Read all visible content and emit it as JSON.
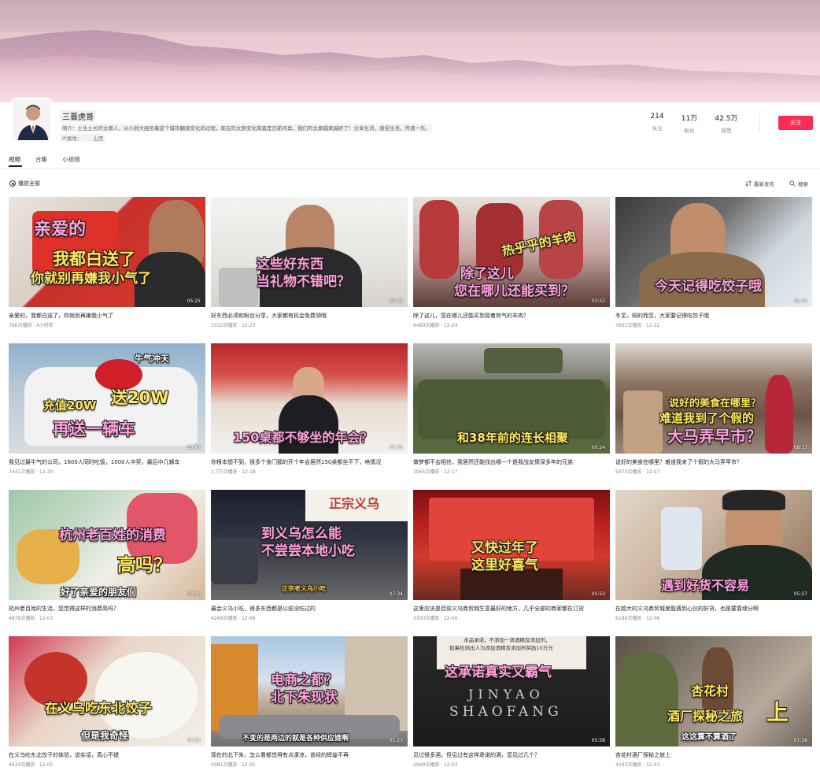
{
  "profile": {
    "name": "三晋虎哥",
    "intro": "简介：土生土长的太原人，从小到大经历着这个城市翻滚变化的过程，现在的太原变化简直是日新月异，我们的太原越来越好了！分享生活，感受生活，传递一乐。",
    "ip_label": "IP属地：",
    "ip_value": "山西",
    "follow_button": "关注"
  },
  "stats": [
    {
      "value": "214",
      "label": "关注"
    },
    {
      "value": "11万",
      "label": "粉丝"
    },
    {
      "value": "42.5万",
      "label": "获赞"
    }
  ],
  "tabs": [
    {
      "label": "视频",
      "active": true
    },
    {
      "label": "合集",
      "active": false
    },
    {
      "label": "小视频",
      "active": false
    }
  ],
  "toolbar": {
    "play_all": "播放全部",
    "sort": "最新发布",
    "search": "搜索"
  },
  "icons": {
    "play_all": "play-circle-icon",
    "sort": "sort-icon",
    "search": "search-icon"
  },
  "colors": {
    "accent": "#fe2c55"
  },
  "videos": [
    {
      "caption_lines": [
        "亲爱的",
        "我都白送了",
        "你就别再嫌我小气了"
      ],
      "duration": "05:25",
      "title": "亲爱的，我都白送了，你就别再嫌我小气了",
      "meta": "796次播放 · 4小时前"
    },
    {
      "caption_lines": [
        "这些好东西",
        "当礼物不错吧？"
      ],
      "duration": "05:33",
      "title": "好东西必须和粉丝分享，大家都有机会免费领哦",
      "meta": "3332次播放 · 12-23"
    },
    {
      "caption_lines": [
        "热乎乎的羊肉",
        "除了这儿",
        "您在哪儿还能买到？"
      ],
      "duration": "03:52",
      "title": "除了这儿，您在哪儿还能买到冒着热气的羊肉？",
      "meta": "6489次播放 · 12-24"
    },
    {
      "caption_lines": [
        "今天记得吃饺子哦"
      ],
      "duration": "01:44",
      "title": "冬至，知的而至，大家要记得吃饺子哦",
      "meta": "3601次播放 · 12-22"
    },
    {
      "caption_lines": [
        "牛气冲天",
        "送20W",
        "充值20W",
        "再送一辆车"
      ],
      "duration": "09:42",
      "title": "我见过最牛气的公司，1600人同时吃饭，1000人中奖，最后中几辆车",
      "meta": "7441次播放 · 12-20"
    },
    {
      "caption_lines": [
        "150桌都不够坐的年会？"
      ],
      "duration": "07:15",
      "title": "你根本想不到，很多个食门那的开个年会居然150桌都坐不下，啥情况",
      "meta": "1.7万次播放 · 12-18"
    },
    {
      "caption_lines": [
        "和38年前的连长相聚"
      ],
      "duration": "00:24",
      "title": "做梦都不会相信，我居然还能找出哪一个是我战友情深多年的兄弟",
      "meta": "3965次播放 · 12-17"
    },
    {
      "caption_lines": [
        "说好的美食在哪里？",
        "难道我到了个假的",
        "大马弄早市？"
      ],
      "duration": "08:17",
      "title": "说好的美食在哪里？难道我来了个假的大马弄早市？",
      "meta": "5073次播放 · 12-07"
    },
    {
      "caption_lines": [
        "杭州老百姓的消费",
        "高吗？",
        "好了亲爱的朋友们"
      ],
      "duration": "08:00",
      "title": "杭州老百姓的生活，您觉得这样的消费高吗？",
      "meta": "4876次播放 · 12-07"
    },
    {
      "caption_lines": [
        "正宗义乌",
        "到义乌怎么能",
        "不尝尝本地小吃",
        "正宗老义乌小吃"
      ],
      "duration": "07:34",
      "title": "最会义乌小吃，很多东西都是以前没吃过的",
      "meta": "4249次播放 · 12-06"
    },
    {
      "caption_lines": [
        "又快过年了",
        "这里好喜气"
      ],
      "duration": "05:53",
      "title": "这里应该是目前义乌商贸城生意最好的地方，几乎全部的商家都在订货",
      "meta": "3300次播放 · 12-06"
    },
    {
      "caption_lines": [
        "遇到好货不容易"
      ],
      "duration": "05:27",
      "title": "在超大的义乌商贸城里能遇到心仪的好货，也是要靠缘分啊",
      "meta": "6186次播放 · 12-06"
    },
    {
      "caption_lines": [
        "在义乌吃东北饺子",
        "但是我奇怪"
      ],
      "duration": "07:27",
      "title": "在义乌吃东北饺子的体验，说实话，真心不错",
      "meta": "4634次播放 · 12-05"
    },
    {
      "caption_lines": [
        "电商之都？",
        "北下朱现状",
        "不变的是两边的就是各种供应链啊"
      ],
      "duration": "05:23",
      "title": "现在的北下朱，怎么看都觉得有点凄凉，曾经的辉煌不再",
      "meta": "4981次播放 · 12-05"
    },
    {
      "caption_lines": [
        "本品承诺，不添加一滴酒精及添加剂，",
        "如果检测出人为添加酒精及添加剂奖励10万元",
        "这承诺真实又霸气",
        "JINYAO",
        "SHAOFANG"
      ],
      "duration": "05:58",
      "title": "见过很多酒，但见过有这样承诺的酒，您见过几个？",
      "meta": "2940次播放 · 12-03"
    },
    {
      "caption_lines": [
        "杏花村",
        "酒厂探秘之旅",
        "上",
        "这这算不算酒了"
      ],
      "duration": "07:58",
      "title": "杏花村酒厂探秘之旅上",
      "meta": "4293次播放 · 12-03"
    }
  ]
}
